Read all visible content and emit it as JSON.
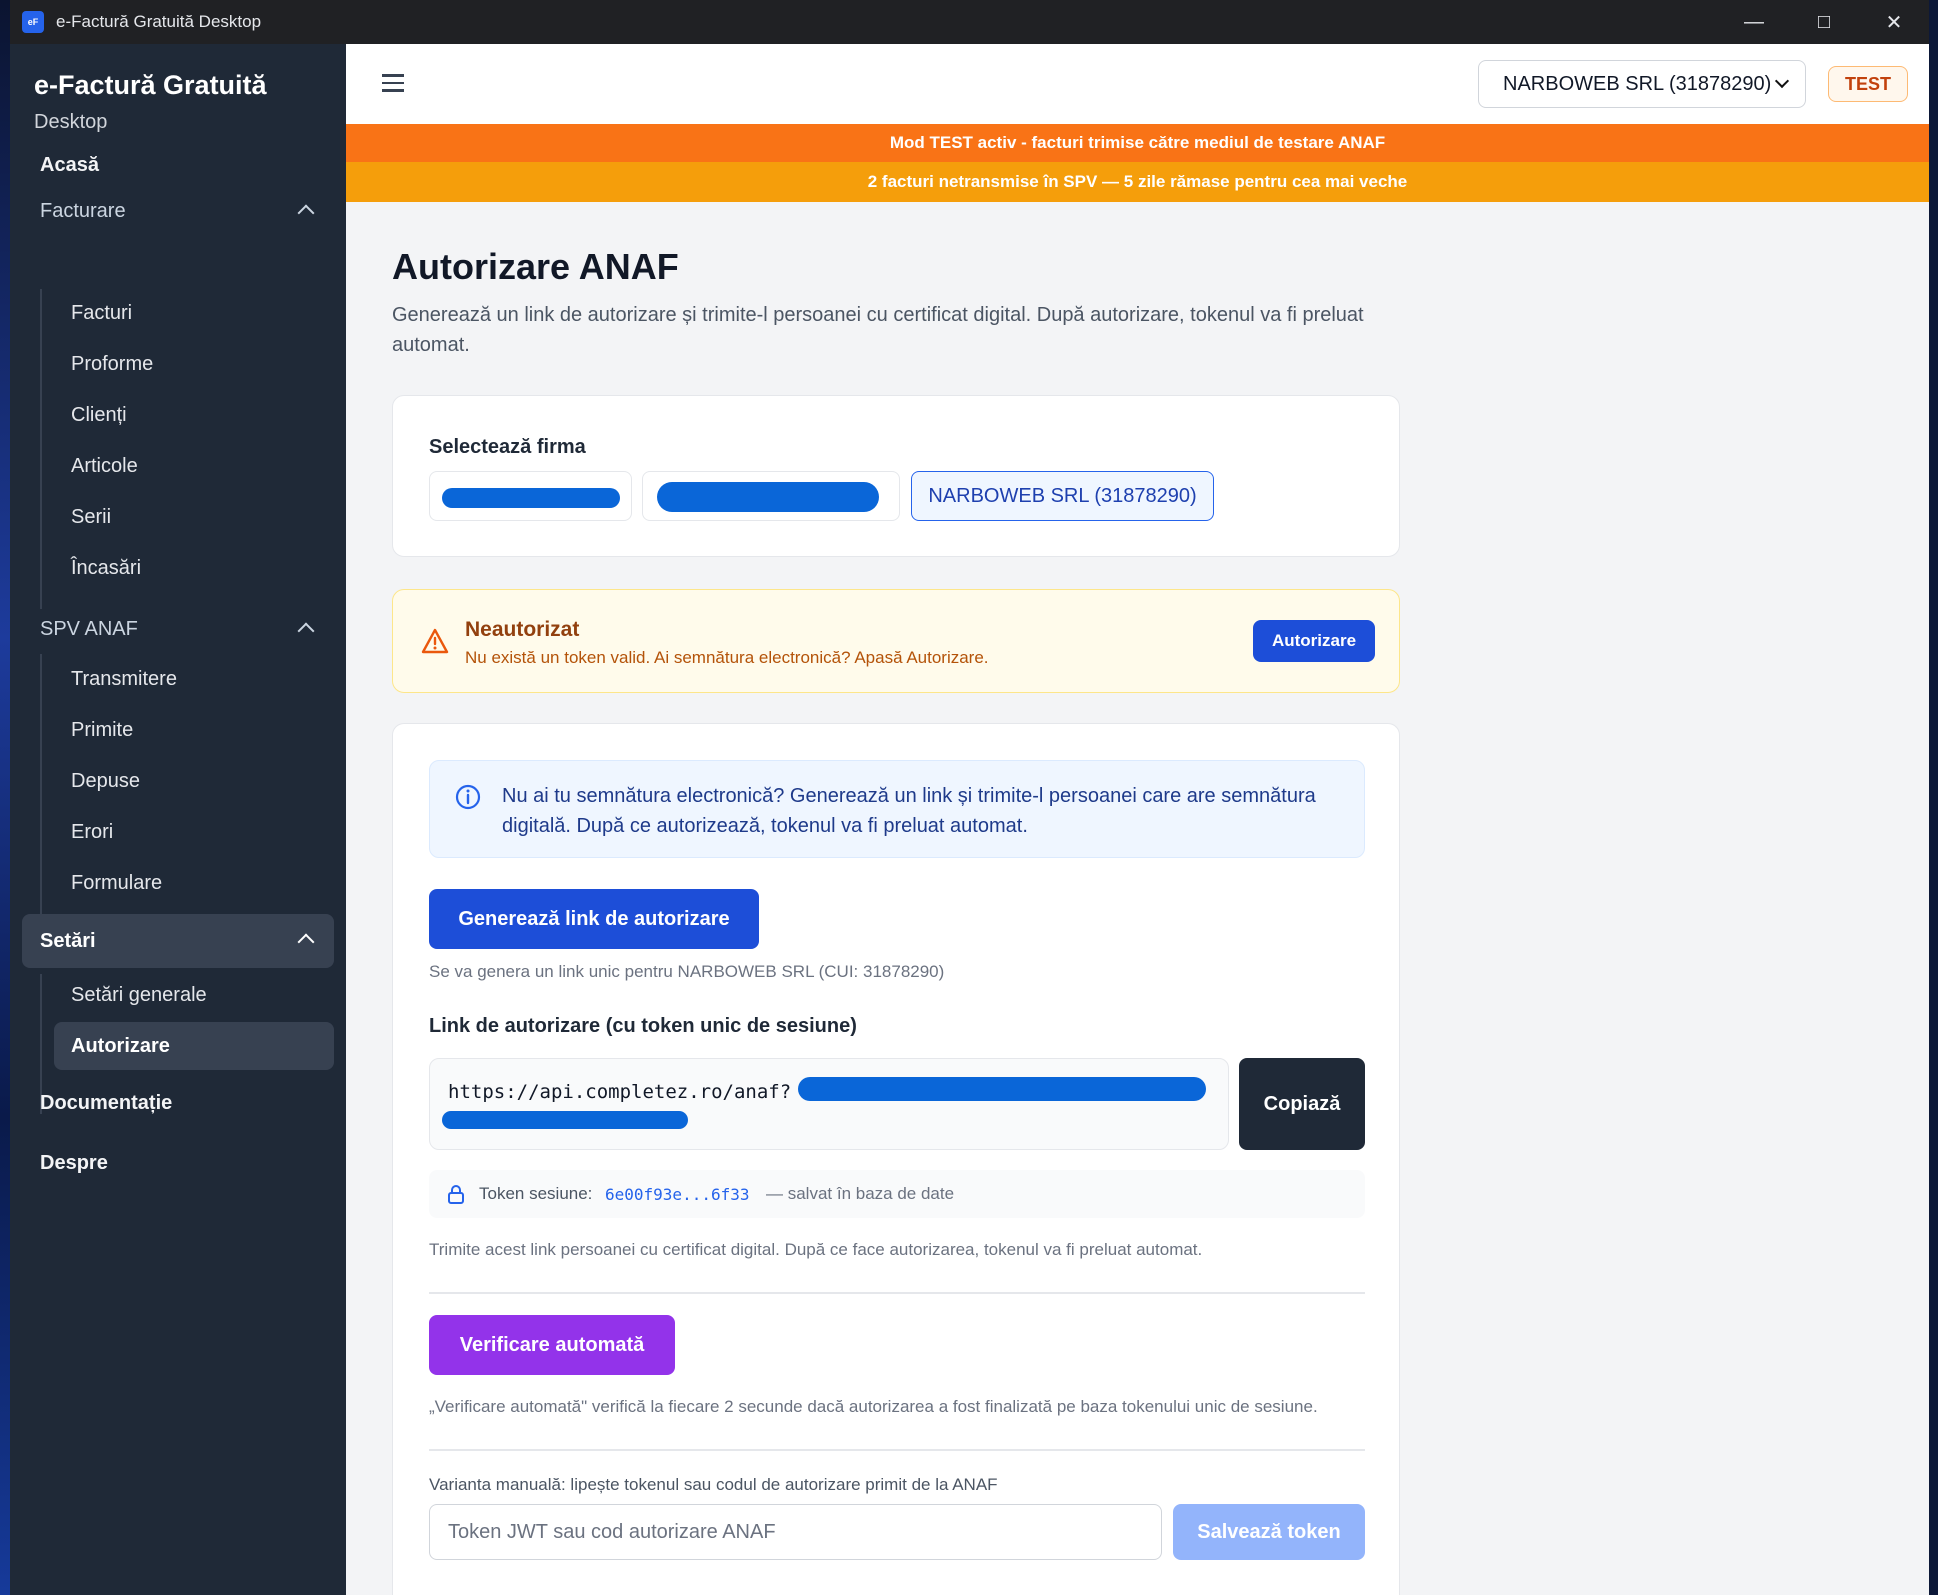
{
  "window": {
    "title": "e-Factură Gratuită Desktop",
    "icon_text": "eF",
    "controls": [
      "minimize",
      "maximize",
      "close"
    ]
  },
  "sidebar": {
    "brand": "e-Factură Gratuită",
    "brand_sub": "Desktop",
    "home": "Acasă",
    "facturare": {
      "label": "Facturare",
      "items": [
        "Facturi",
        "Proforme",
        "Clienți",
        "Articole",
        "Serii",
        "Încasări"
      ]
    },
    "spv": {
      "label": "SPV ANAF",
      "items": [
        "Transmitere",
        "Primite",
        "Depuse",
        "Erori",
        "Formulare"
      ]
    },
    "setari": {
      "label": "Setări",
      "items": [
        "Setări generale",
        "Autorizare"
      ],
      "active": "Autorizare"
    },
    "documentatie": "Documentație",
    "despre": "Despre"
  },
  "topbar": {
    "company_select": "NARBOWEB SRL (31878290)",
    "mode_badge": "TEST"
  },
  "banners": {
    "test_mode": "Mod TEST activ - facturi trimise către mediul de testare ANAF",
    "pending": "2 facturi netransmise în SPV — 5 zile rămase pentru cea mai veche"
  },
  "page": {
    "title": "Autorizare ANAF",
    "lead": "Generează un link de autorizare și trimite-l persoanei cu certificat digital. După autorizare, tokenul va fi preluat automat.",
    "select_company_label": "Selectează firma",
    "selected_company": "NARBOWEB SRL (31878290)",
    "status": {
      "title": "Neautorizat",
      "message": "Nu există un token valid. Ai semnătura electronică? Apasă Autorizare.",
      "button": "Autorizare"
    },
    "info": "Nu ai tu semnătura electronică? Generează un link și trimite-l persoanei care are semnătura digitală. După ce autorizează, tokenul va fi preluat automat.",
    "generate_button": "Generează link de autorizare",
    "generate_hint": "Se va genera un link unic pentru NARBOWEB SRL (CUI: 31878290)",
    "link_label": "Link de autorizare (cu token unic de sesiune)",
    "link_value": "https://api.completez.ro/anaf?",
    "copy_button": "Copiază",
    "token_label": "Token sesiune:",
    "token_value": "6e00f93e...6f33",
    "token_suffix": "— salvat în baza de date",
    "send_hint": "Trimite acest link persoanei cu certificat digital. După ce face autorizarea, tokenul va fi preluat automat.",
    "auto_verify_button": "Verificare automată",
    "auto_verify_hint": "„Verificare automată\" verifică la fiecare 2 secunde dacă autorizarea a fost finalizată pe baza tokenului unic de sesiune.",
    "manual_label": "Varianta manuală: lipește tokenul sau codul de autorizare primit de la ANAF",
    "manual_placeholder": "Token JWT sau cod autorizare ANAF",
    "save_button": "Salvează token"
  },
  "colors": {
    "accent": "#1d4ed8",
    "purple": "#9333ea",
    "orange": "#f97316",
    "amber": "#f59e0b",
    "sidebar": "#1f2937"
  }
}
